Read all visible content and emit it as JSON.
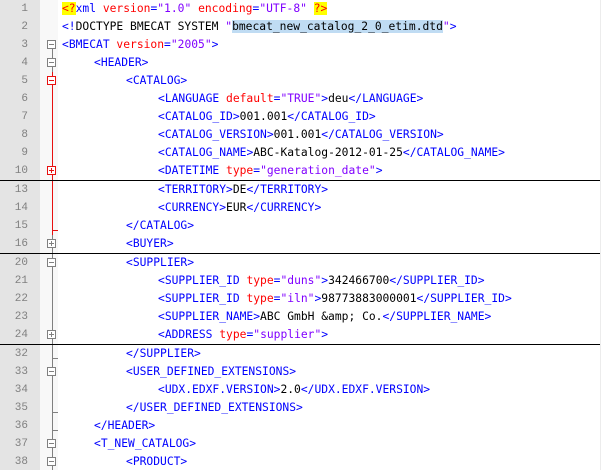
{
  "editor": {
    "lines": [
      {
        "n": "1",
        "indent": 0,
        "fold": "none",
        "parts": [
          [
            "hl-y",
            "<?"
          ],
          [
            "bk",
            "xml "
          ],
          [
            "at",
            "version"
          ],
          [
            "bk",
            "="
          ],
          [
            "va",
            "\"1.0\""
          ],
          [
            "bk",
            " "
          ],
          [
            "at",
            "encoding"
          ],
          [
            "bk",
            "="
          ],
          [
            "va",
            "\"UTF-8\""
          ],
          [
            "bk",
            " "
          ],
          [
            "hl-y",
            "?>"
          ]
        ]
      },
      {
        "n": "2",
        "indent": 0,
        "fold": "none",
        "parts": [
          [
            "bk",
            "<!"
          ],
          [
            "tx",
            "DOCTYPE BMECAT SYSTEM "
          ],
          [
            "va",
            "\""
          ],
          [
            "hl-c",
            "bmecat_new_catalog_2_0_etim.dtd"
          ],
          [
            "va",
            "\""
          ],
          [
            "bk",
            ">"
          ]
        ]
      },
      {
        "n": "3",
        "indent": 0,
        "fold": "open",
        "parts": [
          [
            "bk",
            "<"
          ],
          [
            "tg",
            "BMECAT "
          ],
          [
            "at",
            "version"
          ],
          [
            "bk",
            "="
          ],
          [
            "va",
            "\"2005\""
          ],
          [
            "bk",
            ">"
          ]
        ]
      },
      {
        "n": "4",
        "indent": 1,
        "fold": "open",
        "parts": [
          [
            "bk",
            "<"
          ],
          [
            "tg",
            "HEADER"
          ],
          [
            "bk",
            ">"
          ]
        ]
      },
      {
        "n": "5",
        "indent": 2,
        "fold": "open-red",
        "parts": [
          [
            "bk",
            "<"
          ],
          [
            "tg",
            "CATALOG"
          ],
          [
            "bk",
            ">"
          ]
        ]
      },
      {
        "n": "6",
        "indent": 3,
        "fold": "line-red",
        "parts": [
          [
            "bk",
            "<"
          ],
          [
            "tg",
            "LANGUAGE "
          ],
          [
            "at",
            "default"
          ],
          [
            "bk",
            "="
          ],
          [
            "va",
            "\"TRUE\""
          ],
          [
            "bk",
            ">"
          ],
          [
            "tx",
            "deu"
          ],
          [
            "bk",
            "</"
          ],
          [
            "tg",
            "LANGUAGE"
          ],
          [
            "bk",
            ">"
          ]
        ]
      },
      {
        "n": "7",
        "indent": 3,
        "fold": "line-red",
        "parts": [
          [
            "bk",
            "<"
          ],
          [
            "tg",
            "CATALOG_ID"
          ],
          [
            "bk",
            ">"
          ],
          [
            "tx",
            "001.001"
          ],
          [
            "bk",
            "</"
          ],
          [
            "tg",
            "CATALOG_ID"
          ],
          [
            "bk",
            ">"
          ]
        ]
      },
      {
        "n": "8",
        "indent": 3,
        "fold": "line-red",
        "parts": [
          [
            "bk",
            "<"
          ],
          [
            "tg",
            "CATALOG_VERSION"
          ],
          [
            "bk",
            ">"
          ],
          [
            "tx",
            "001.001"
          ],
          [
            "bk",
            "</"
          ],
          [
            "tg",
            "CATALOG_VERSION"
          ],
          [
            "bk",
            ">"
          ]
        ]
      },
      {
        "n": "9",
        "indent": 3,
        "fold": "line-red",
        "parts": [
          [
            "bk",
            "<"
          ],
          [
            "tg",
            "CATALOG_NAME"
          ],
          [
            "bk",
            ">"
          ],
          [
            "tx",
            "ABC-Katalog-2012-01-25"
          ],
          [
            "bk",
            "</"
          ],
          [
            "tg",
            "CATALOG_NAME"
          ],
          [
            "bk",
            ">"
          ]
        ]
      },
      {
        "n": "10",
        "indent": 3,
        "fold": "closed-red",
        "sep": true,
        "parts": [
          [
            "bk",
            "<"
          ],
          [
            "tg",
            "DATETIME "
          ],
          [
            "at",
            "type"
          ],
          [
            "bk",
            "="
          ],
          [
            "va",
            "\"generation_date\""
          ],
          [
            "bk",
            ">"
          ]
        ]
      },
      {
        "n": "13",
        "indent": 3,
        "fold": "line-red",
        "parts": [
          [
            "bk",
            "<"
          ],
          [
            "tg",
            "TERRITORY"
          ],
          [
            "bk",
            ">"
          ],
          [
            "tx",
            "DE"
          ],
          [
            "bk",
            "</"
          ],
          [
            "tg",
            "TERRITORY"
          ],
          [
            "bk",
            ">"
          ]
        ]
      },
      {
        "n": "14",
        "indent": 3,
        "fold": "line-red",
        "parts": [
          [
            "bk",
            "<"
          ],
          [
            "tg",
            "CURRENCY"
          ],
          [
            "bk",
            ">"
          ],
          [
            "tx",
            "EUR"
          ],
          [
            "bk",
            "</"
          ],
          [
            "tg",
            "CURRENCY"
          ],
          [
            "bk",
            ">"
          ]
        ]
      },
      {
        "n": "15",
        "indent": 2,
        "fold": "end-red",
        "parts": [
          [
            "bk",
            "</"
          ],
          [
            "tg",
            "CATALOG"
          ],
          [
            "bk",
            ">"
          ]
        ]
      },
      {
        "n": "16",
        "indent": 2,
        "fold": "closed",
        "sep": true,
        "parts": [
          [
            "bk",
            "<"
          ],
          [
            "tg",
            "BUYER"
          ],
          [
            "bk",
            ">"
          ]
        ]
      },
      {
        "n": "20",
        "indent": 2,
        "fold": "open",
        "parts": [
          [
            "bk",
            "<"
          ],
          [
            "tg",
            "SUPPLIER"
          ],
          [
            "bk",
            ">"
          ]
        ]
      },
      {
        "n": "21",
        "indent": 3,
        "fold": "line",
        "parts": [
          [
            "bk",
            "<"
          ],
          [
            "tg",
            "SUPPLIER_ID "
          ],
          [
            "at",
            "type"
          ],
          [
            "bk",
            "="
          ],
          [
            "va",
            "\"duns\""
          ],
          [
            "bk",
            ">"
          ],
          [
            "tx",
            "342466700"
          ],
          [
            "bk",
            "</"
          ],
          [
            "tg",
            "SUPPLIER_ID"
          ],
          [
            "bk",
            ">"
          ]
        ]
      },
      {
        "n": "22",
        "indent": 3,
        "fold": "line",
        "parts": [
          [
            "bk",
            "<"
          ],
          [
            "tg",
            "SUPPLIER_ID "
          ],
          [
            "at",
            "type"
          ],
          [
            "bk",
            "="
          ],
          [
            "va",
            "\"iln\""
          ],
          [
            "bk",
            ">"
          ],
          [
            "tx",
            "98773883000001"
          ],
          [
            "bk",
            "</"
          ],
          [
            "tg",
            "SUPPLIER_ID"
          ],
          [
            "bk",
            ">"
          ]
        ]
      },
      {
        "n": "23",
        "indent": 3,
        "fold": "line",
        "parts": [
          [
            "bk",
            "<"
          ],
          [
            "tg",
            "SUPPLIER_NAME"
          ],
          [
            "bk",
            ">"
          ],
          [
            "tx",
            "ABC GmbH &amp; Co."
          ],
          [
            "bk",
            "</"
          ],
          [
            "tg",
            "SUPPLIER_NAME"
          ],
          [
            "bk",
            ">"
          ]
        ]
      },
      {
        "n": "24",
        "indent": 3,
        "fold": "closed",
        "sep": true,
        "parts": [
          [
            "bk",
            "<"
          ],
          [
            "tg",
            "ADDRESS "
          ],
          [
            "at",
            "type"
          ],
          [
            "bk",
            "="
          ],
          [
            "va",
            "\"supplier\""
          ],
          [
            "bk",
            ">"
          ]
        ]
      },
      {
        "n": "32",
        "indent": 2,
        "fold": "end",
        "parts": [
          [
            "bk",
            "</"
          ],
          [
            "tg",
            "SUPPLIER"
          ],
          [
            "bk",
            ">"
          ]
        ]
      },
      {
        "n": "33",
        "indent": 2,
        "fold": "open",
        "parts": [
          [
            "bk",
            "<"
          ],
          [
            "tg",
            "USER_DEFINED_EXTENSIONS"
          ],
          [
            "bk",
            ">"
          ]
        ]
      },
      {
        "n": "34",
        "indent": 3,
        "fold": "line",
        "parts": [
          [
            "bk",
            "<"
          ],
          [
            "tg",
            "UDX.EDXF.VERSION"
          ],
          [
            "bk",
            ">"
          ],
          [
            "tx",
            "2.0"
          ],
          [
            "bk",
            "</"
          ],
          [
            "tg",
            "UDX.EDXF.VERSION"
          ],
          [
            "bk",
            ">"
          ]
        ]
      },
      {
        "n": "35",
        "indent": 2,
        "fold": "end",
        "parts": [
          [
            "bk",
            "</"
          ],
          [
            "tg",
            "USER_DEFINED_EXTENSIONS"
          ],
          [
            "bk",
            ">"
          ]
        ]
      },
      {
        "n": "36",
        "indent": 1,
        "fold": "end",
        "parts": [
          [
            "bk",
            "</"
          ],
          [
            "tg",
            "HEADER"
          ],
          [
            "bk",
            ">"
          ]
        ]
      },
      {
        "n": "37",
        "indent": 1,
        "fold": "open",
        "parts": [
          [
            "bk",
            "<"
          ],
          [
            "tg",
            "T_NEW_CATALOG"
          ],
          [
            "bk",
            ">"
          ]
        ]
      },
      {
        "n": "38",
        "indent": 2,
        "fold": "open",
        "parts": [
          [
            "bk",
            "<"
          ],
          [
            "tg",
            "PRODUCT"
          ],
          [
            "bk",
            ">"
          ]
        ]
      }
    ]
  }
}
